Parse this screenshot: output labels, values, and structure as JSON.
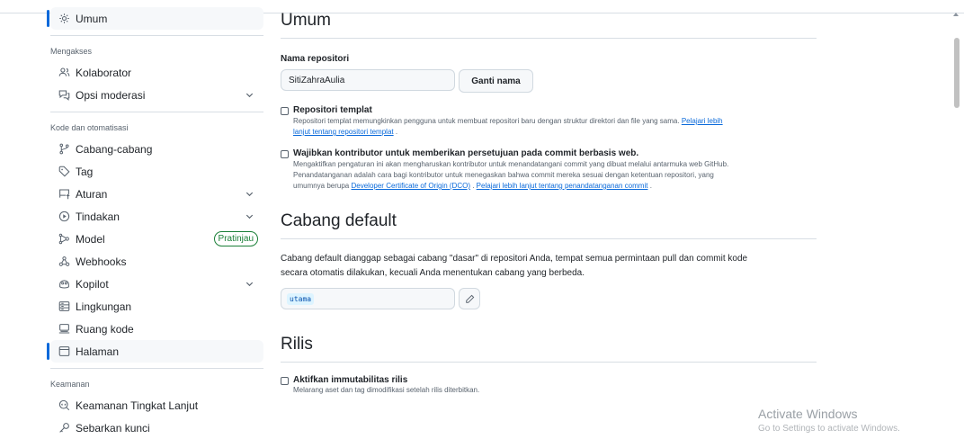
{
  "sidebar": {
    "active_label": "Umum",
    "section_access": "Mengakses",
    "collaborators": "Kolaborator",
    "moderation": "Opsi moderasi",
    "section_code": "Kode dan otomatisasi",
    "branches": "Cabang-cabang",
    "tags": "Tag",
    "rules": "Aturan",
    "actions": "Tindakan",
    "models": "Model",
    "models_badge": "Pratinjau",
    "webhooks": "Webhooks",
    "copilot": "Kopilot",
    "environments": "Lingkungan",
    "codespaces": "Ruang kode",
    "pages": "Halaman",
    "section_security": "Keamanan",
    "advanced_security": "Keamanan Tingkat Lanjut",
    "deploy_keys": "Sebarkan kunci"
  },
  "main": {
    "general_title": "Umum",
    "repo_name_label": "Nama repositori",
    "repo_name_value": "SitiZahraAulia",
    "rename_button": "Ganti nama",
    "template_title": "Repositori templat",
    "template_note": "Repositori templat memungkinkan pengguna untuk membuat repositori baru dengan struktur direktori dan file yang sama.",
    "template_link_1": "Pelajari lebih",
    "template_link_2": "lanjut tentang repositori templat",
    "signoff_title": "Wajibkan kontributor untuk memberikan persetujuan pada commit berbasis web.",
    "signoff_note_1": "Mengaktifkan pengaturan ini akan mengharuskan kontributor untuk menandatangani commit yang dibuat melalui antarmuka web GitHub.",
    "signoff_note_2": "Penandatanganan adalah cara bagi kontributor untuk menegaskan bahwa commit mereka sesuai dengan ketentuan repositori, yang",
    "signoff_note_3": "umumnya berupa",
    "signoff_link_dco": "Developer Certificate of Origin (DCO)",
    "signoff_link_learn": "Pelajari lebih lanjut tentang penandatanganan commit",
    "default_branch_title": "Cabang default",
    "default_branch_text_1": "Cabang default dianggap sebagai cabang \"dasar\" di repositori Anda, tempat semua permintaan pull dan commit kode",
    "default_branch_text_2": "secara otomatis dilakukan, kecuali Anda menentukan cabang yang berbeda.",
    "default_branch_value": "utama",
    "releases_title": "Rilis",
    "immutable_title": "Aktifkan immutabilitas rilis",
    "immutable_note": "Melarang aset dan tag dimodifikasi setelah rilis diterbitkan."
  },
  "watermark": {
    "line1": "Activate Windows",
    "line2": "Go to Settings to activate Windows."
  },
  "colors": {
    "accent": "#0969da",
    "success": "#1a7f37",
    "border": "#d8dee4"
  }
}
